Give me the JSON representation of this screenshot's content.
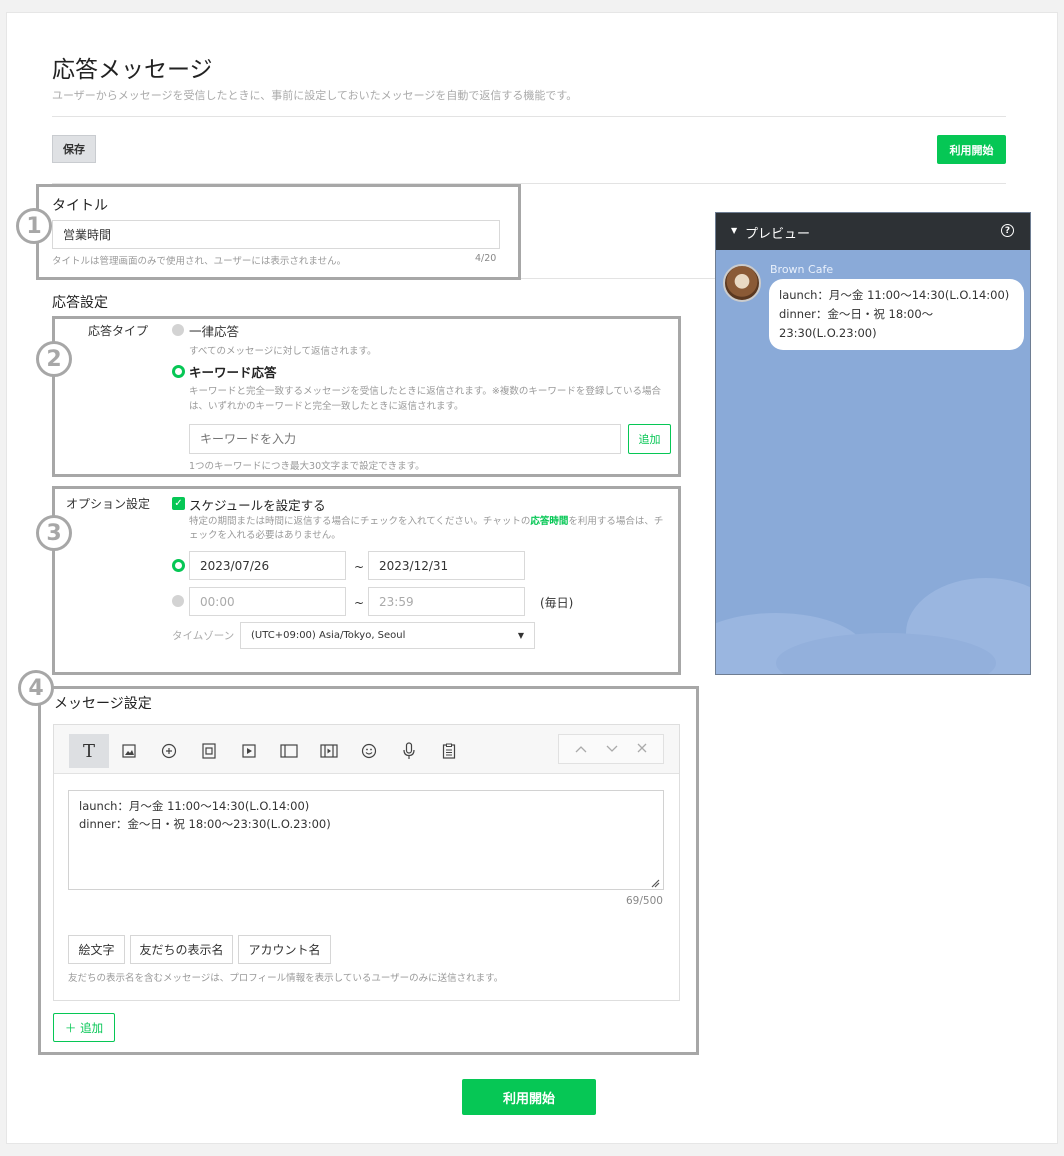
{
  "page": {
    "title": "応答メッセージ",
    "subtitle": "ユーザーからメッセージを受信したときに、事前に設定しておいたメッセージを自動で返信する機能です。",
    "save_label": "保存",
    "start_label": "利用開始",
    "start_bottom_label": "利用開始"
  },
  "badges": [
    "1",
    "2",
    "3",
    "4"
  ],
  "title_section": {
    "label": "タイトル",
    "value": "営業時間",
    "hint": "タイトルは管理画面のみで使用され、ユーザーには表示されません。",
    "counter": "4/20"
  },
  "response_settings": {
    "label": "応答設定",
    "type_label": "応答タイプ",
    "option_all": "一律応答",
    "option_all_hint": "すべてのメッセージに対して返信されます。",
    "option_keyword": "キーワード応答",
    "option_keyword_hint_1": "キーワードと完全一致するメッセージを受信したときに返信されます。※複数のキーワードを登録している場合",
    "option_keyword_hint_2": "は、いずれかのキーワードと完全一致したときに返信されます。",
    "keyword_placeholder": "キーワードを入力",
    "add_label": "追加",
    "keyword_limit_hint": "1つのキーワードにつき最大30文字まで設定できます。"
  },
  "option_settings": {
    "label": "オプション設定",
    "schedule_label": "スケジュールを設定する",
    "schedule_hint_a": "特定の期間または時間に返信する場合にチェックを入れてください。チャットの",
    "schedule_hint_link": "応答時間",
    "schedule_hint_b": "を利用する場合は、チ",
    "schedule_hint_2": "ェックを入れる必要はありません。",
    "date_from": "2023/07/26",
    "date_to": "2023/12/31",
    "tilde": "~",
    "time_from": "00:00",
    "time_to": "23:59",
    "daily": "(毎日)",
    "timezone_label": "タイムゾーン",
    "timezone_value": "(UTC+09:00) Asia/Tokyo, Seoul"
  },
  "message_settings": {
    "label": "メッセージ設定",
    "toolbar_text_icon": "T",
    "message_text": "launch：月～金 11:00～14:30(L.O.14:00)\ndinner：金～日・祝 18:00～23:30(L.O.23:00)",
    "counter": "69/500",
    "emoji_button": "絵文字",
    "friend_name_button": "友だちの表示名",
    "account_name_button": "アカウント名",
    "friend_name_hint": "友だちの表示名を含むメッセージは、プロフィール情報を表示しているユーザーのみに送信されます。",
    "add_button": "＋ 追加"
  },
  "preview": {
    "title": "プレビュー",
    "sender": "Brown Cafe",
    "line1": "launch：月～金 11:00～14:30(L.O.14:00)",
    "line2": "dinner：金～日・祝 18:00～",
    "line3": "23:30(L.O.23:00)"
  },
  "colors": {
    "brand_green": "#06c755",
    "preview_bg": "#8aaad8",
    "preview_header": "#2d3135",
    "callout_border": "#a7a7a7"
  }
}
